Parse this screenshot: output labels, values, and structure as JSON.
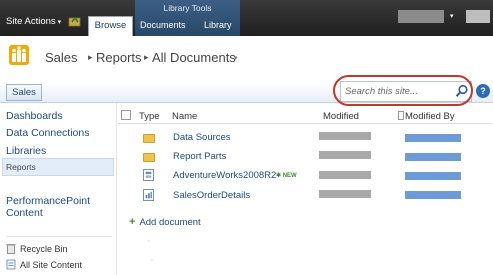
{
  "ribbon": {
    "site_actions": "Site Actions",
    "site_actions_arrow": "▾",
    "tab_browse": "Browse",
    "contextual_group": "Library Tools",
    "tab_documents": "Documents",
    "tab_library": "Library",
    "user_menu_arrow": "▾"
  },
  "header": {
    "site_title": "Sales",
    "separator": "▸",
    "crumb_reports": "Reports",
    "crumb_current": "All Documents",
    "current_arrow": "▾"
  },
  "topnav": {
    "tab_sales": "Sales"
  },
  "search": {
    "placeholder": "Search this site...",
    "help": "?"
  },
  "leftnav": {
    "items": [
      "Dashboards",
      "Data Connections",
      "Libraries"
    ],
    "reports": "Reports",
    "performancepoint": "PerformancePoint Content",
    "recycle_bin": "Recycle Bin",
    "all_site_content": "All Site Content"
  },
  "list": {
    "columns": {
      "type": "Type",
      "name": "Name",
      "modified": "Modified",
      "modified_by": "Modified By"
    },
    "rows": [
      {
        "name": "Data Sources",
        "icon": "folder-icon",
        "new": ""
      },
      {
        "name": "Report Parts",
        "icon": "folder-icon",
        "new": ""
      },
      {
        "name": "AdventureWorks2008R2",
        "icon": "data-source-icon",
        "new": "NEW"
      },
      {
        "name": "SalesOrderDetails",
        "icon": "report-icon",
        "new": ""
      }
    ],
    "add_document": "Add document",
    "add_plus": "+"
  },
  "colors": {
    "ribbon": "#2a2a2a",
    "contextual_tab": "#3d5f86",
    "link": "#1d4a7d",
    "highlight_oval": "#c0392b",
    "modified_by_blur": "#6c9bd6"
  }
}
